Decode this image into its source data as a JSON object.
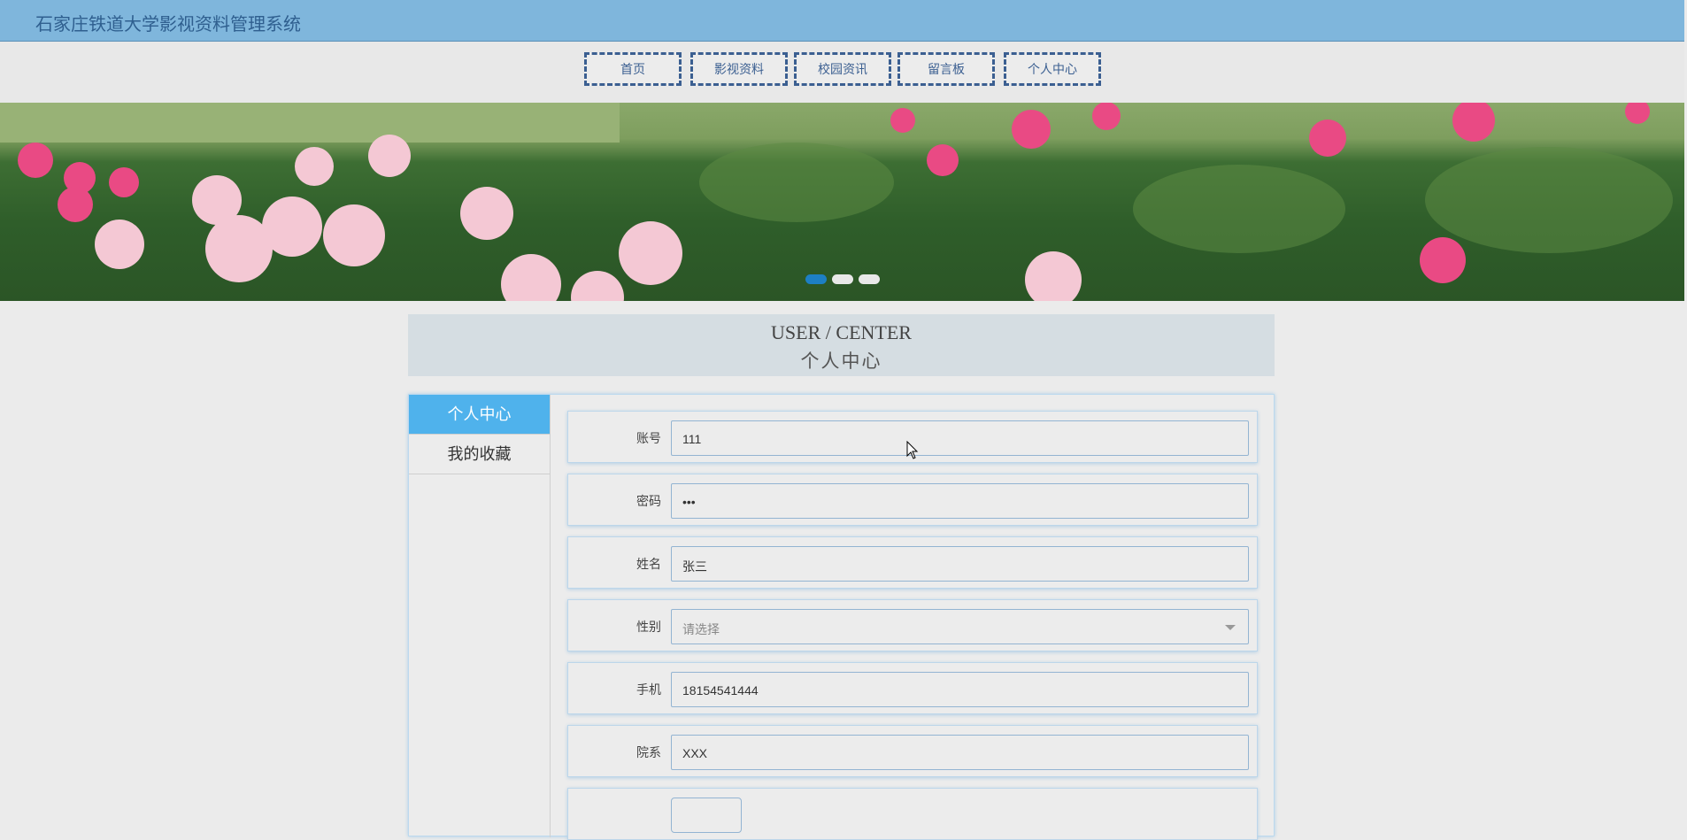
{
  "header": {
    "title": "石家庄铁道大学影视资料管理系统"
  },
  "nav": [
    {
      "label": "首页"
    },
    {
      "label": "影视资料"
    },
    {
      "label": "校园资讯"
    },
    {
      "label": "留言板"
    },
    {
      "label": "个人中心"
    }
  ],
  "banner": {
    "slides": 3,
    "active_slide": 1
  },
  "user_center": {
    "title_en": "USER / CENTER",
    "title_cn": "个人中心"
  },
  "sidebar": {
    "items": [
      {
        "label": "个人中心",
        "active": true
      },
      {
        "label": "我的收藏",
        "active": false
      }
    ]
  },
  "form": {
    "account": {
      "label": "账号",
      "value": "111"
    },
    "password": {
      "label": "密码",
      "value": "•••"
    },
    "name": {
      "label": "姓名",
      "value": "张三"
    },
    "gender": {
      "label": "性别",
      "placeholder": "请选择"
    },
    "phone": {
      "label": "手机",
      "value": "18154541444"
    },
    "department": {
      "label": "院系",
      "value": "XXX"
    }
  },
  "colors": {
    "topbar": "#7fb6dc",
    "accent": "#4fb2ec",
    "nav_border": "#3b5f91"
  }
}
